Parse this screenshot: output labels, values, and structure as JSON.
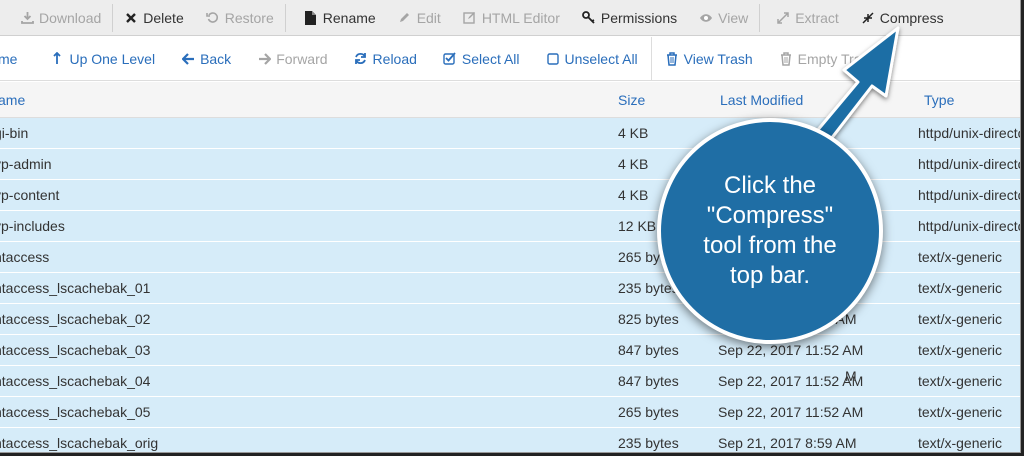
{
  "toolbar": {
    "items": [
      {
        "label": "Download",
        "icon": "download-icon",
        "enabled": false
      },
      {
        "label": "Delete",
        "icon": "close-icon",
        "enabled": true
      },
      {
        "label": "Restore",
        "icon": "restore-icon",
        "enabled": false
      },
      {
        "label": "Rename",
        "icon": "file-icon",
        "enabled": true
      },
      {
        "label": "Edit",
        "icon": "pencil-icon",
        "enabled": false
      },
      {
        "label": "HTML Editor",
        "icon": "edit-square-icon",
        "enabled": false
      },
      {
        "label": "Permissions",
        "icon": "key-icon",
        "enabled": true
      },
      {
        "label": "View",
        "icon": "eye-icon",
        "enabled": false
      },
      {
        "label": "Extract",
        "icon": "expand-icon",
        "enabled": false
      },
      {
        "label": "Compress",
        "icon": "compress-icon",
        "enabled": true
      }
    ]
  },
  "nav": {
    "items": [
      {
        "label": "me",
        "icon": "",
        "enabled": true
      },
      {
        "label": "Up One Level",
        "icon": "up-arrow-icon",
        "enabled": true
      },
      {
        "label": "Back",
        "icon": "left-arrow-icon",
        "enabled": true
      },
      {
        "label": "Forward",
        "icon": "right-arrow-icon",
        "enabled": false
      },
      {
        "label": "Reload",
        "icon": "refresh-icon",
        "enabled": true
      },
      {
        "label": "Select All",
        "icon": "checkbox-checked-icon",
        "enabled": true
      },
      {
        "label": "Unselect All",
        "icon": "checkbox-empty-icon",
        "enabled": true
      },
      {
        "label": "View Trash",
        "icon": "trash-icon",
        "enabled": true
      },
      {
        "label": "Empty Trash",
        "icon": "trash-icon",
        "enabled": false
      }
    ]
  },
  "table": {
    "headers": {
      "name": "ame",
      "size": "Size",
      "modified": "Last Modified",
      "type": "Type"
    },
    "rows": [
      {
        "name": "gi-bin",
        "size": "4 KB",
        "modified": "",
        "type": "httpd/unix-directory"
      },
      {
        "name": "vp-admin",
        "size": "4 KB",
        "modified": "",
        "type": "httpd/unix-directory"
      },
      {
        "name": "vp-content",
        "size": "4 KB",
        "modified": "",
        "type": "httpd/unix-directory"
      },
      {
        "name": "vp-includes",
        "size": "12 KB",
        "modified": "",
        "type": "httpd/unix-directory"
      },
      {
        "name": "ntaccess",
        "size": "265 bytes",
        "modified": "",
        "type": "text/x-generic"
      },
      {
        "name": "ntaccess_lscachebak_01",
        "size": "235 bytes",
        "modified": "",
        "type": "text/x-generic"
      },
      {
        "name": "ntaccess_lscachebak_02",
        "size": "825 bytes",
        "modified": "Sep 22, 2017 8:59 AM",
        "type": "text/x-generic"
      },
      {
        "name": "ntaccess_lscachebak_03",
        "size": "847 bytes",
        "modified": "Sep 22, 2017 11:52 AM",
        "type": "text/x-generic"
      },
      {
        "name": "ntaccess_lscachebak_04",
        "size": "847 bytes",
        "modified": "Sep 22, 2017 11:52 AM",
        "type": "text/x-generic"
      },
      {
        "name": "ntaccess_lscachebak_05",
        "size": "265 bytes",
        "modified": "Sep 22, 2017 11:52 AM",
        "type": "text/x-generic"
      },
      {
        "name": "ntaccess_lscachebak_orig",
        "size": "235 bytes",
        "modified": "Sep 21, 2017 8:59 AM",
        "type": "text/x-generic"
      }
    ],
    "partial_modified": {
      "row0": "AM",
      "row5": "M"
    }
  },
  "callout": {
    "text": "Click the \"Compress\" tool from the top bar.",
    "color": "#1f6ea5"
  },
  "colors": {
    "link": "#2a6ebb",
    "row_selected": "#d6ecf9",
    "disabled": "#a5a5a5"
  }
}
